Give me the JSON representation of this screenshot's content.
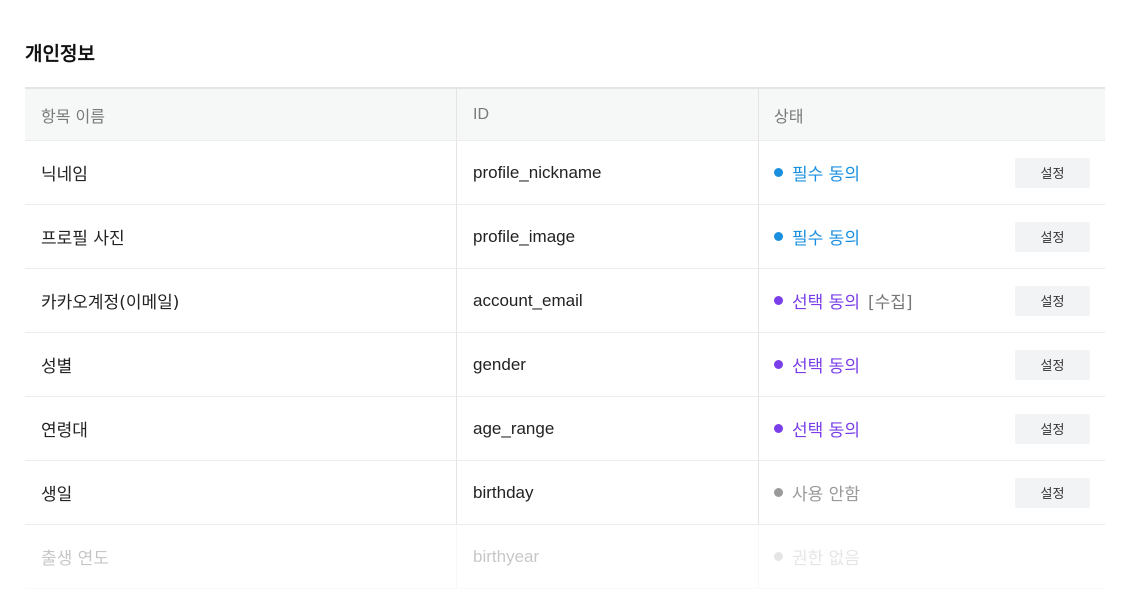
{
  "section_title": "개인정보",
  "table": {
    "headers": [
      "항목 이름",
      "ID",
      "상태"
    ],
    "rows": [
      {
        "name": "닉네임",
        "id": "profile_nickname",
        "status": "필수 동의",
        "status_color": "#1a8fe0",
        "suffix": "",
        "button": "설정"
      },
      {
        "name": "프로필 사진",
        "id": "profile_image",
        "status": "필수 동의",
        "status_color": "#1a8fe0",
        "suffix": "",
        "button": "설정"
      },
      {
        "name": "카카오계정(이메일)",
        "id": "account_email",
        "status": "선택 동의",
        "status_color": "#7a3ee8",
        "suffix": "[수집]",
        "button": "설정"
      },
      {
        "name": "성별",
        "id": "gender",
        "status": "선택 동의",
        "status_color": "#7a3ee8",
        "suffix": "",
        "button": "설정"
      },
      {
        "name": "연령대",
        "id": "age_range",
        "status": "선택 동의",
        "status_color": "#7a3ee8",
        "suffix": "",
        "button": "설정"
      },
      {
        "name": "생일",
        "id": "birthday",
        "status": "사용 안함",
        "status_color": "#9a9a9a",
        "suffix": "",
        "button": "설정"
      },
      {
        "name": "출생 연도",
        "id": "birthyear",
        "status": "권한 없음",
        "status_color": "#9a9a9a",
        "suffix": "",
        "button": ""
      }
    ]
  }
}
